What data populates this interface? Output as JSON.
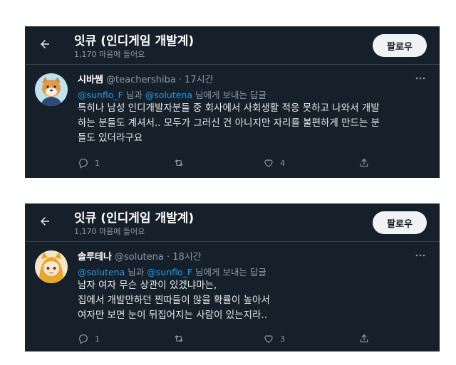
{
  "cards": [
    {
      "header": {
        "name": "잇큐 (인디게임 개발계)",
        "likes": "1,170 마음에 들어요",
        "follow_label": "팔로우"
      },
      "tweet": {
        "display_name": "시바쌤",
        "handle_time": "@teachershiba · 17시간",
        "reply_mention1": "@sunflo_F",
        "reply_and": " 님과 ",
        "reply_mention2": "@solutena",
        "reply_suffix": " 님에게 보내는 답글",
        "lines": [
          "특히나 남성 인디개발자분들 중 회사에서 사회생활 적응 못하고 나와서 개발",
          "하는 분들도 계셔서.. 모두가 그러신 건 아니지만 자리를 불편하게 만드는 분",
          "들도 있더라구요"
        ],
        "reply_count": "1",
        "like_count": "4"
      }
    },
    {
      "header": {
        "name": "잇큐 (인디게임 개발계)",
        "likes": "1,170 마음에 들어요",
        "follow_label": "팔로우"
      },
      "tweet": {
        "display_name": "솔루테나",
        "handle_time": "@solutena · 18시간",
        "reply_mention1": "@solutena",
        "reply_and": " 님과 ",
        "reply_mention2": "@sunflo_F",
        "reply_suffix": " 님에게 보내는 답글",
        "lines": [
          "남자 여자 무슨 상관이 있겠냐마는,",
          "집에서 개발만하던 찐따들이 많을 확률이 높아서",
          "여자만 보면 눈이 뒤집어지는 사람이 있는지라.."
        ],
        "reply_count": "1",
        "like_count": "3"
      }
    }
  ],
  "icons": {
    "back": "arrow-left-icon",
    "more": "more-dots-icon",
    "reply": "reply-icon",
    "retweet": "retweet-icon",
    "like": "heart-icon",
    "share": "share-icon"
  },
  "colors": {
    "background": "#15202b",
    "text": "#e7e9ea",
    "secondary": "#8b98a5",
    "mention": "#1d9bf0",
    "follow_bg": "#eff3f4"
  }
}
